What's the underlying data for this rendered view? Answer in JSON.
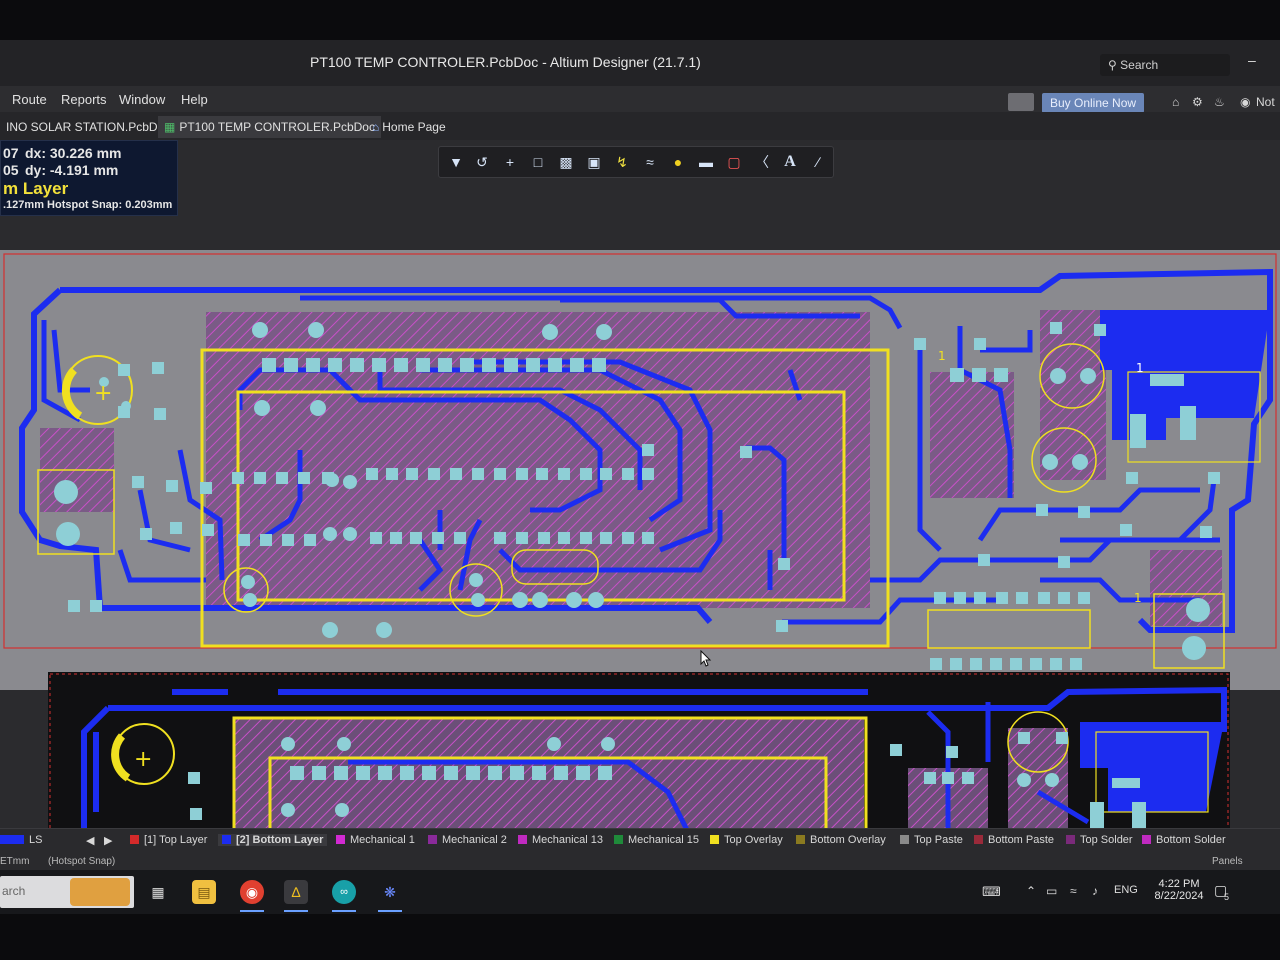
{
  "window": {
    "title": "PT100 TEMP CONTROLER.PcbDoc - Altium Designer (21.7.1)",
    "search_label": "Search",
    "minimize_glyph": "–"
  },
  "menu": {
    "items": [
      "Route",
      "Reports",
      "Window",
      "Help"
    ],
    "buy_label": "Buy Online Now",
    "account_label": "Not",
    "icons": [
      "chat-icon",
      "home-icon",
      "gear-icon",
      "bell-icon",
      "user-icon"
    ]
  },
  "tabs": [
    {
      "label": "INO SOLAR STATION.PcbDoc",
      "active": false
    },
    {
      "label": "PT100 TEMP CONTROLER.PcbDoc",
      "active": true
    },
    {
      "label": "Home Page",
      "active": false
    }
  ],
  "info_panel": {
    "line1_prefix": "07",
    "dx": "dx: 30.226 mm",
    "line2_prefix": "05",
    "dy": "dy: -4.191  mm",
    "layer": "m Layer",
    "snap": ".127mm Hotspot Snap: 0.203mm"
  },
  "toolbar": {
    "icons": [
      "filter-icon",
      "route-icon",
      "add-icon",
      "select-rect-icon",
      "align-icon",
      "component-icon",
      "interactive-route-icon",
      "diff-pair-icon",
      "via-icon",
      "fill-icon",
      "polygon-icon",
      "dimension-icon",
      "text-icon",
      "line-icon"
    ]
  },
  "layers": {
    "current": "LS",
    "items": [
      {
        "label": "[1] Top Layer",
        "color": "#d42a2a"
      },
      {
        "label": "[2] Bottom Layer",
        "color": "#1c2cf0",
        "active": true
      },
      {
        "label": "Mechanical 1",
        "color": "#d22ad2"
      },
      {
        "label": "Mechanical 2",
        "color": "#8a2a9a"
      },
      {
        "label": "Mechanical 13",
        "color": "#c02ac0"
      },
      {
        "label": "Mechanical 15",
        "color": "#1f8a3a"
      },
      {
        "label": "Top Overlay",
        "color": "#f0e020"
      },
      {
        "label": "Bottom Overlay",
        "color": "#8a7a20"
      },
      {
        "label": "Top Paste",
        "color": "#8a8a8a"
      },
      {
        "label": "Bottom Paste",
        "color": "#9a2a3a"
      },
      {
        "label": "Top Solder",
        "color": "#7a2a7a"
      },
      {
        "label": "Bottom Solder",
        "color": "#c02ac0"
      }
    ]
  },
  "status": {
    "units": "ETmm",
    "snap": "(Hotspot Snap)",
    "panels": "Panels"
  },
  "taskbar": {
    "search_label": "arch",
    "language": "ENG",
    "time": "4:22 PM",
    "date": "8/22/2024",
    "notification_count": "5"
  },
  "colors": {
    "bottom_copper": "#1c2cf0",
    "overlay": "#f0e020",
    "pad": "#8ecfd6",
    "board_fill": "#7a5b86"
  }
}
